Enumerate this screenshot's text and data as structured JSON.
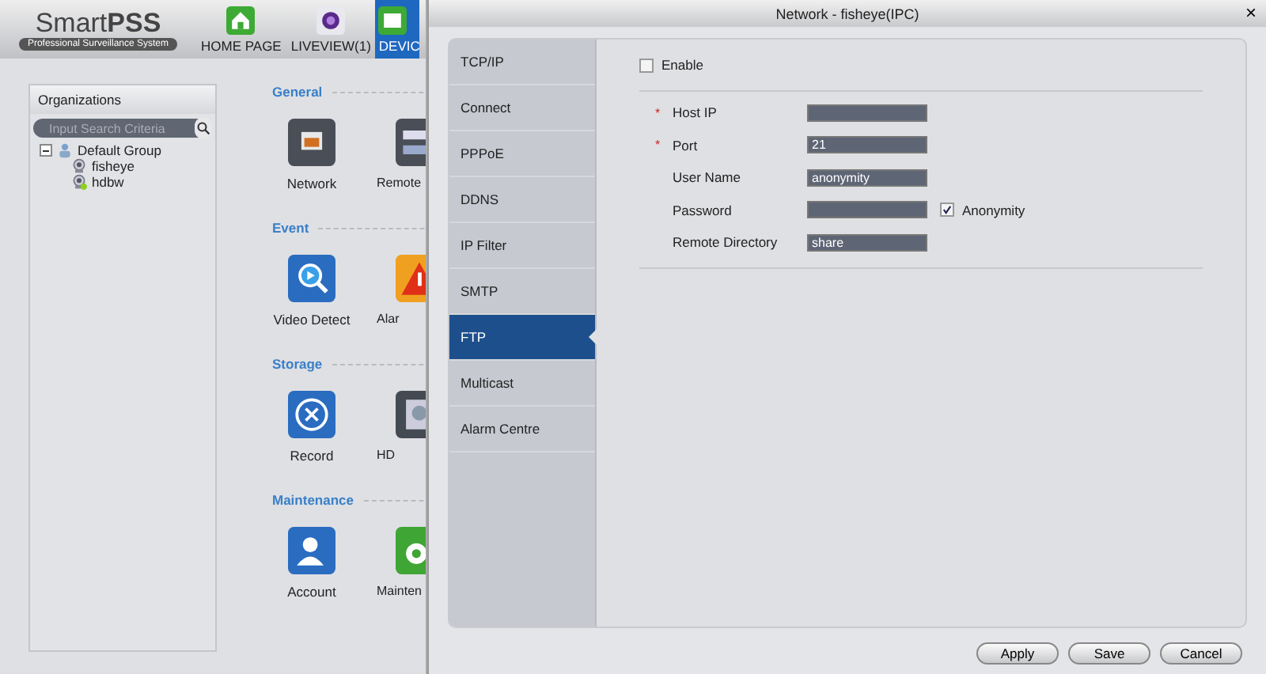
{
  "app": {
    "logo_title": "Smart**PSS**",
    "logo_subtitle": "Professional Surveillance System",
    "nav": [
      {
        "label": "HOME PAGE",
        "selected": false
      },
      {
        "label": "LIVEVIEW(1)",
        "selected": false
      },
      {
        "label": "DEVIC",
        "selected": true
      }
    ]
  },
  "organizations": {
    "title": "Organizations",
    "search": {
      "placeholder": "Input Search Criteria"
    },
    "tree": [
      {
        "label": "Default Group",
        "expanded": true,
        "children": [
          {
            "label": "fisheye",
            "online": false
          },
          {
            "label": "hdbw",
            "online": true
          }
        ]
      }
    ]
  },
  "sections": [
    {
      "title": "General",
      "items": [
        {
          "label": "Network"
        },
        {
          "label": "Remote"
        }
      ]
    },
    {
      "title": "Event",
      "items": [
        {
          "label": "Video Detect"
        },
        {
          "label": "Alar"
        }
      ]
    },
    {
      "title": "Storage",
      "items": [
        {
          "label": "Record"
        },
        {
          "label": "HD"
        }
      ]
    },
    {
      "title": "Maintenance",
      "items": [
        {
          "label": "Account"
        },
        {
          "label": "Mainten"
        }
      ]
    }
  ],
  "dialog": {
    "title": "Network - fisheye(IPC)",
    "close": "×",
    "tabs": [
      {
        "label": "TCP/IP",
        "selected": false
      },
      {
        "label": "Connect",
        "selected": false
      },
      {
        "label": "PPPoE",
        "selected": false
      },
      {
        "label": "DDNS",
        "selected": false
      },
      {
        "label": "IP Filter",
        "selected": false
      },
      {
        "label": "SMTP",
        "selected": false
      },
      {
        "label": "FTP",
        "selected": true
      },
      {
        "label": "Multicast",
        "selected": false
      },
      {
        "label": "Alarm Centre",
        "selected": false
      }
    ],
    "enable": {
      "label": "Enable",
      "checked": false
    },
    "fields": [
      {
        "marker": "*",
        "label": "Host IP"
      },
      {
        "marker": "*",
        "label": "Port",
        "value": "21"
      },
      {
        "label": "User Name",
        "value": "anonymity"
      },
      {
        "label": "Password",
        "option": {
          "label": "Anonymity",
          "checked": true
        }
      },
      {
        "label": "Remote Directory",
        "value": "share"
      }
    ],
    "buttons": [
      "Apply",
      "Save",
      "Cancel"
    ]
  }
}
